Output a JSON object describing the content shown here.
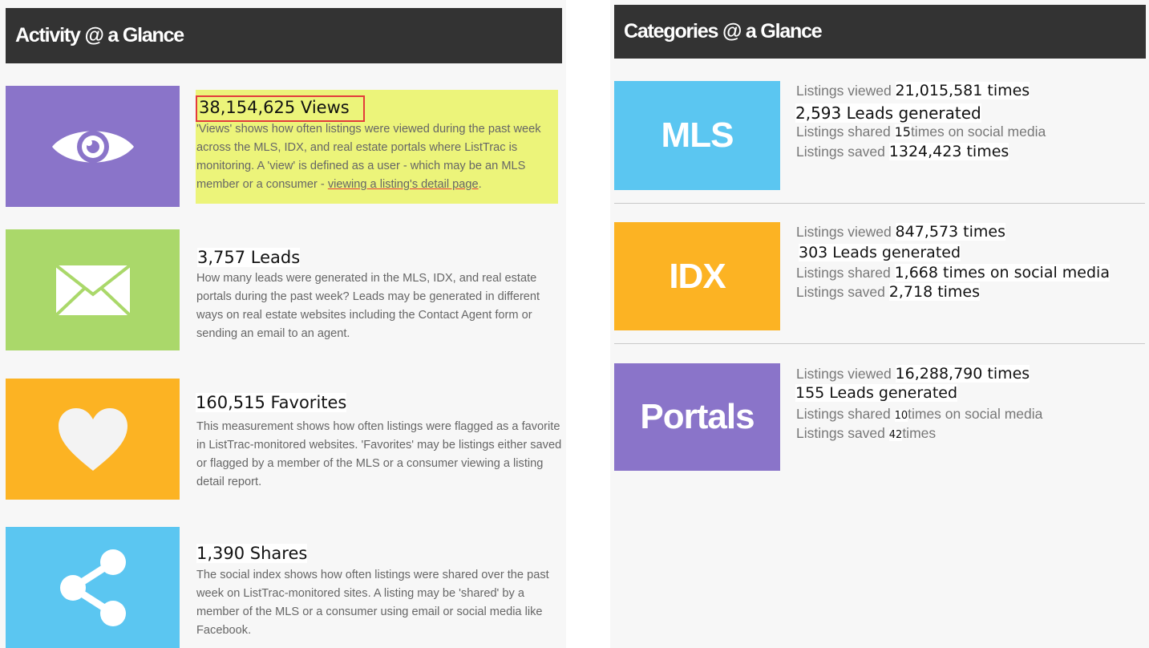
{
  "activity": {
    "title": "Activity @ a Glance",
    "items": [
      {
        "icon": "eye-icon",
        "color": "#8a74c9",
        "headline": "38,154,625 Views",
        "desc_main": "'Views' shows how often listings were viewed during the past week across the MLS, IDX, and real estate portals where ListTrac is monitoring. A 'view' is defined as a user - which may be an MLS member or a consumer - ",
        "desc_link": "viewing a listing's detail page",
        "desc_end": "."
      },
      {
        "icon": "envelope-icon",
        "color": "#aad86a",
        "headline": "3,757 Leads",
        "desc": "How many leads were generated in the MLS, IDX, and real estate portals during the past week? Leads may be generated in different ways on real estate websites including the Contact Agent form or sending an email to an agent."
      },
      {
        "icon": "heart-icon",
        "color": "#fcb323",
        "headline": "160,515 Favorites",
        "desc": "This measurement shows how often listings were flagged as a favorite in ListTrac-monitored websites. 'Favorites' may be listings either saved or flagged by a member of the MLS or a consumer  viewing a listing detail report."
      },
      {
        "icon": "share-icon",
        "color": "#5bc6f1",
        "headline": "1,390 Shares",
        "desc": "The social index shows how often listings were shared over the past week on ListTrac-monitored sites.  A listing may be 'shared'  by a member of the MLS or a consumer using email or social media like Facebook."
      }
    ]
  },
  "categories": {
    "title": "Categories @ a Glance",
    "items": [
      {
        "label": "MLS",
        "color": "#5bc6f1",
        "viewed_prefix": "Listings viewed ",
        "viewed_value": "21,015,581 times",
        "leads": "2,593 Leads generated",
        "shared_prefix": "Listings shared ",
        "shared_value": "15",
        "shared_suffix": "times on social media",
        "saved_prefix": "Listings saved ",
        "saved_value": "1324,423 times"
      },
      {
        "label": "IDX",
        "color": "#fcb323",
        "viewed_prefix": "Listings viewed ",
        "viewed_value": "847,573 times",
        "leads": "303 Leads generated",
        "shared_prefix": "Listings shared ",
        "shared_value": "1,668 times on social media",
        "shared_suffix": "",
        "saved_prefix": "Listings saved ",
        "saved_value": "2,718 times"
      },
      {
        "label": "Portals",
        "color": "#8a74c9",
        "viewed_prefix": "Listings viewed ",
        "viewed_value": "16,288,790 times",
        "leads": "155 Leads generated",
        "shared_prefix": "Listings shared ",
        "shared_value": "10",
        "shared_suffix": "times on social media",
        "saved_prefix": "Listings saved ",
        "saved_value": "42",
        "saved_suffix": "times"
      }
    ]
  }
}
